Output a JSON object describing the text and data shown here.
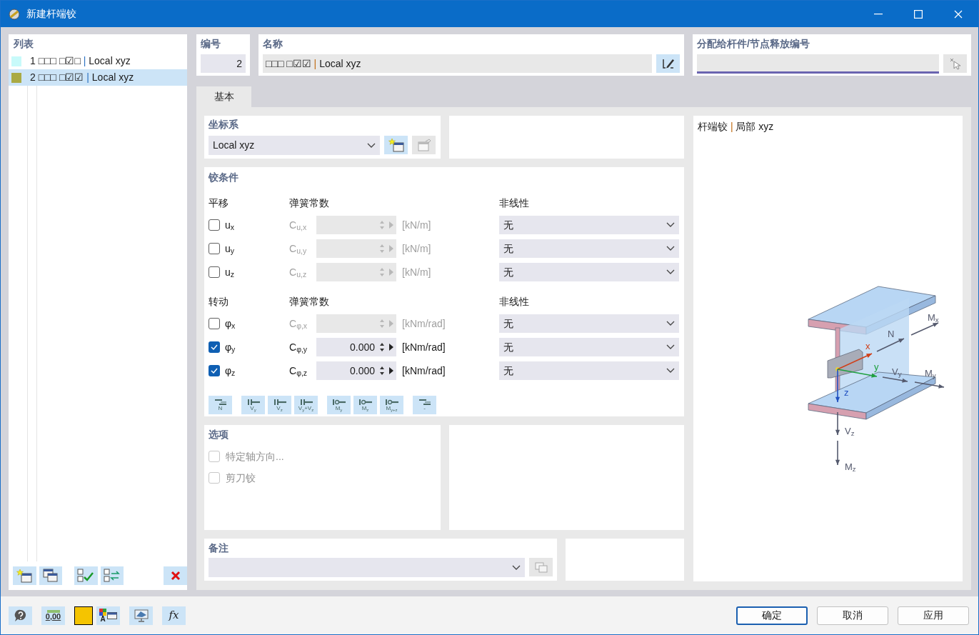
{
  "window": {
    "title": "新建杆端铰"
  },
  "list": {
    "title": "列表",
    "items": [
      {
        "number": "1",
        "code": "□□□ □☑□",
        "separator": "|",
        "name": "Local xyz",
        "color": "#c8fafa",
        "selected": false
      },
      {
        "number": "2",
        "code": "□□□ □☑☑",
        "separator": "|",
        "name": "Local xyz",
        "color": "#aaaa44",
        "selected": true
      }
    ]
  },
  "number_field": {
    "label": "编号",
    "value": "2"
  },
  "name_field": {
    "label": "名称",
    "code": "□□□ □☑☑",
    "separator": "|",
    "value": "Local xyz"
  },
  "assign_field": {
    "label": "分配给杆件/节点释放编号"
  },
  "tabs": [
    {
      "label": "基本",
      "selected": true
    }
  ],
  "coordinate_system": {
    "label": "坐标系",
    "value": "Local xyz"
  },
  "hinge_conditions": {
    "title": "铰条件",
    "groups": [
      {
        "label": "平移",
        "spring_label": "弹簧常数",
        "nonlinear_label": "非线性",
        "rows": [
          {
            "symbol": "u$_{x}$",
            "checked": false,
            "constant": "C$_{u,x}$",
            "unit": "[kN/m]",
            "nonlinearity": "无"
          },
          {
            "symbol": "u$_{y}$",
            "checked": false,
            "constant": "C$_{u,y}$",
            "unit": "[kN/m]",
            "nonlinearity": "无"
          },
          {
            "symbol": "u$_{z}$",
            "checked": false,
            "constant": "C$_{u,z}$",
            "unit": "[kN/m]",
            "nonlinearity": "无"
          }
        ]
      },
      {
        "label": "转动",
        "spring_label": "弹簧常数",
        "nonlinear_label": "非线性",
        "rows": [
          {
            "symbol": "φ$_{x}$",
            "checked": false,
            "constant": "C$_{φ,x}$",
            "unit": "[kNm/rad]",
            "nonlinearity": "无"
          },
          {
            "symbol": "φ$_{y}$",
            "checked": true,
            "constant": "C$_{φ,y}$",
            "value": "0.000",
            "unit": "[kNm/rad]",
            "nonlinearity": "无"
          },
          {
            "symbol": "φ$_{z}$",
            "checked": true,
            "constant": "C$_{φ,z}$",
            "value": "0.000",
            "unit": "[kNm/rad]",
            "nonlinearity": "无"
          }
        ]
      }
    ],
    "presets": [
      [
        {
          "kind": "axial",
          "label": "N"
        }
      ],
      [
        {
          "kind": "shear",
          "label": "V$_{y}$"
        },
        {
          "kind": "shear",
          "label": "V$_{z}$"
        },
        {
          "kind": "shear",
          "label": "V$_{y}$+V$_{z}$"
        }
      ],
      [
        {
          "kind": "moment",
          "label": "M$_{y}$"
        },
        {
          "kind": "moment",
          "label": "M$_{z}$"
        },
        {
          "kind": "moment",
          "label": "M$_{y+z}$"
        }
      ],
      [
        {
          "kind": "axial",
          "label": "-"
        }
      ]
    ]
  },
  "options": {
    "title": "选项",
    "items": [
      {
        "label": "特定轴方向...",
        "checked": false,
        "disabled": true
      },
      {
        "label": "剪刀铰",
        "checked": false,
        "disabled": true
      }
    ]
  },
  "comment": {
    "label": "备注"
  },
  "diagram": {
    "title": "杆端铰",
    "separator": "|",
    "subtitle": "局部 xyz",
    "labels": [
      "M$_{x}$",
      "N",
      "x",
      "y",
      "V$_{y}$",
      "M$_{y}$",
      "z",
      "V$_{z}$",
      "M$_{z}$"
    ]
  },
  "footer": {
    "decimal_label": "0,00",
    "color": "#f5c400",
    "text_icon_label": "A",
    "formula_label": "fx",
    "buttons": [
      {
        "label": "确定",
        "default": true
      },
      {
        "label": "取消",
        "default": false
      },
      {
        "label": "应用",
        "default": false
      }
    ]
  }
}
